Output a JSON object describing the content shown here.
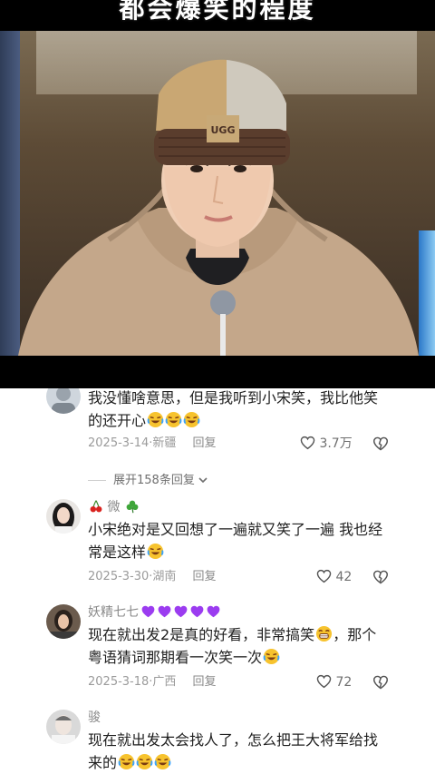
{
  "video": {
    "caption": "都会爆笑的程度",
    "hat_brand": "UGG"
  },
  "comments": [
    {
      "username": "",
      "text": "我没懂啥意思，但是我听到小宋笑，我比他笑的还开心",
      "emojis": [
        "laugh-cry-emoji",
        "laugh-cry-emoji",
        "laugh-cry-emoji"
      ],
      "date": "2025-3-14",
      "location": "新疆",
      "reply_label": "回复",
      "likes": "3.7万",
      "expand_label": "展开158条回复"
    },
    {
      "username": "微",
      "username_emojis": [
        "cherry-emoji",
        "clover-emoji"
      ],
      "text": "小宋绝对是又回想了一遍就又笑了一遍 我也经常是这样",
      "emojis": [
        "laugh-cry-emoji"
      ],
      "date": "2025-3-30",
      "location": "湖南",
      "reply_label": "回复",
      "likes": "42"
    },
    {
      "username": "妖精七七",
      "username_emojis": [
        "purple-heart-emoji",
        "purple-heart-emoji",
        "purple-heart-emoji",
        "purple-heart-emoji",
        "purple-heart-emoji"
      ],
      "text_part1": "现在就出发2是真的好看，非常搞笑",
      "text_part2": "，那个粤语猜词那期看一次笑一次",
      "date": "2025-3-18",
      "location": "广西",
      "reply_label": "回复",
      "likes": "72"
    },
    {
      "username": "骏",
      "text": "现在就出发太会找人了，怎么把王大将军给找来的",
      "emojis": [
        "laugh-cry-emoji",
        "laugh-cry-emoji",
        "laugh-cry-emoji"
      ]
    }
  ],
  "colors": {
    "meta_gray": "#9b9b9b",
    "text_dark": "#1f1f1f",
    "emoji_yellow": "#f7c32e",
    "purple_heart": "#9b3cf0"
  }
}
